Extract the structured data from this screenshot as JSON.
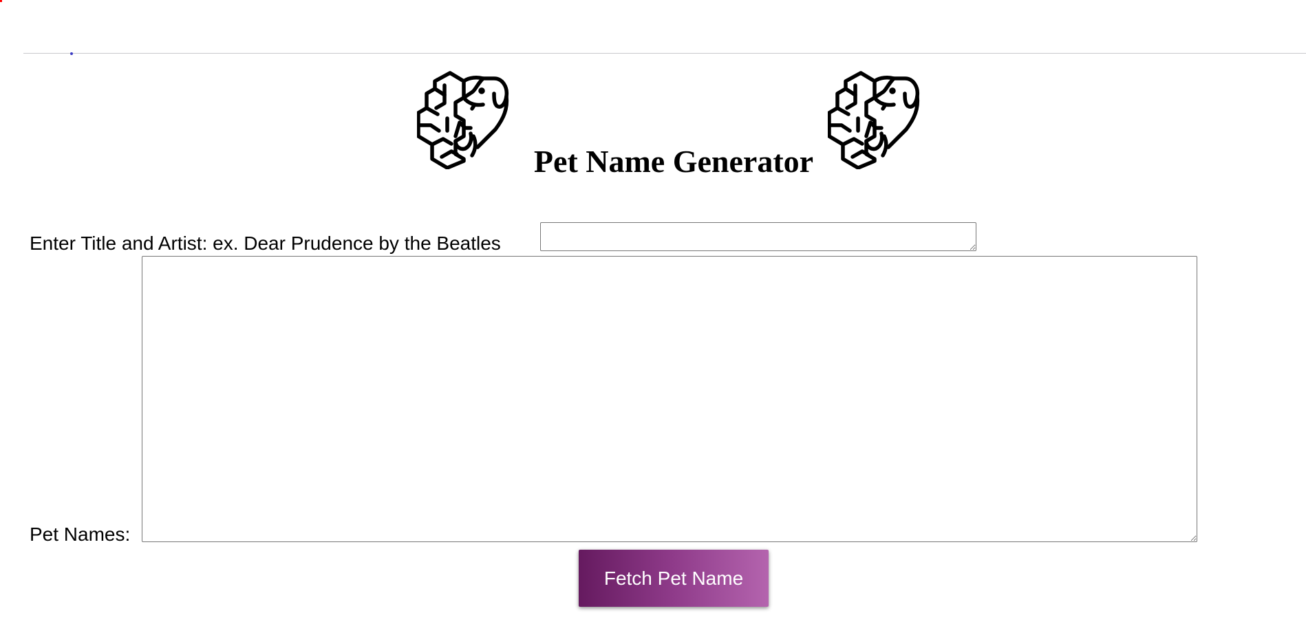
{
  "page": {
    "title": "Pet Name Generator"
  },
  "header": {
    "logo_icon": "brain-dog-cat-icon"
  },
  "form": {
    "song_label": "Enter Title and Artist: ex. Dear Prudence by the Beatles",
    "song_value": "",
    "names_label": "Pet Names:",
    "names_value": "",
    "fetch_label": "Fetch Pet Name"
  },
  "colors": {
    "button_gradient_start": "#651a5f",
    "button_gradient_end": "#b464ae",
    "button_text": "#ffffff",
    "divider": "#c8c8cc"
  }
}
